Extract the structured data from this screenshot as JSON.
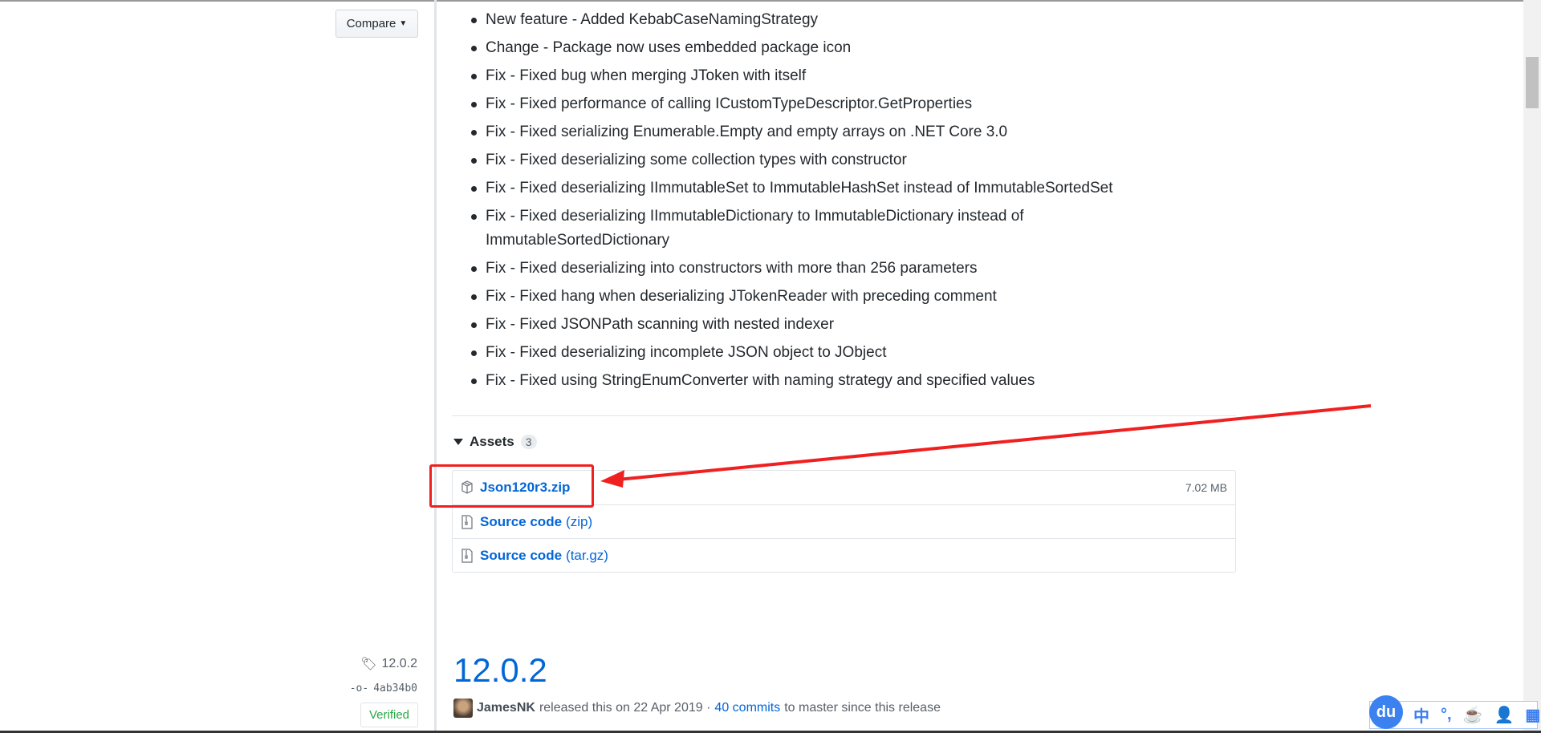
{
  "sidebar": {
    "compare_label": "Compare",
    "tag": "12.0.2",
    "commit": "4ab34b0",
    "verified": "Verified"
  },
  "notes": [
    "New feature - Added KebabCaseNamingStrategy",
    "Change - Package now uses embedded package icon",
    "Fix - Fixed bug when merging JToken with itself",
    "Fix - Fixed performance of calling ICustomTypeDescriptor.GetProperties",
    "Fix - Fixed serializing Enumerable.Empty and empty arrays on .NET Core 3.0",
    "Fix - Fixed deserializing some collection types with constructor",
    "Fix - Fixed deserializing IImmutableSet to ImmutableHashSet instead of ImmutableSortedSet",
    "Fix - Fixed deserializing IImmutableDictionary to ImmutableDictionary instead of ImmutableSortedDictionary",
    "Fix - Fixed deserializing into constructors with more than 256 parameters",
    "Fix - Fixed hang when deserializing JTokenReader with preceding comment",
    "Fix - Fixed JSONPath scanning with nested indexer",
    "Fix - Fixed deserializing incomplete JSON object to JObject",
    "Fix - Fixed using StringEnumConverter with naming strategy and specified values"
  ],
  "assets": {
    "title": "Assets",
    "count": "3",
    "items": [
      {
        "name": "Json120r3.zip",
        "size": "7.02 MB",
        "icon": "package-icon"
      },
      {
        "name": "Source code",
        "sub": "(zip)",
        "icon": "file-zip-icon"
      },
      {
        "name": "Source code",
        "sub": "(tar.gz)",
        "icon": "file-zip-icon"
      }
    ]
  },
  "next_release": {
    "title": "12.0.2",
    "author": "JamesNK",
    "released": "released this on 22 Apr 2019 ·",
    "commits": "40 commits",
    "suffix": "to master since this release"
  },
  "ime": {
    "logo": "du",
    "items": [
      "中",
      "°,"
    ]
  },
  "colors": {
    "link": "#0366d6",
    "annotation": "#f02020",
    "verified": "#28a745"
  }
}
